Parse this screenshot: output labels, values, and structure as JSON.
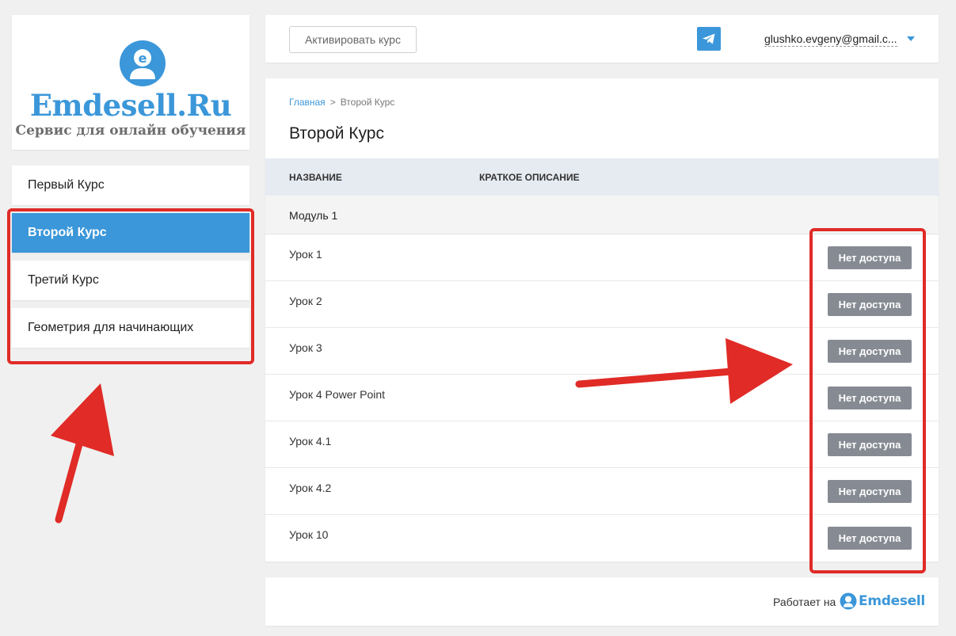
{
  "logo": {
    "title": "Emdesell.Ru",
    "subtitle": "Сервис для онлайн обучения"
  },
  "sidebar": {
    "items": [
      {
        "label": "Первый Курс",
        "active": false
      },
      {
        "label": "Второй Курс",
        "active": true
      },
      {
        "label": "Третий Курс",
        "active": false
      },
      {
        "label": "Геометрия для начинающих",
        "active": false
      }
    ]
  },
  "header": {
    "activate_label": "Активировать курс",
    "telegram_icon": "telegram-icon",
    "user_email": "glushko.evgeny@gmail.c..."
  },
  "breadcrumb": {
    "home": "Главная",
    "separator": ">",
    "current": "Второй Курс"
  },
  "page_title": "Второй Курс",
  "table": {
    "columns": [
      "Название",
      "Краткое описание"
    ],
    "module": "Модуль 1",
    "lessons": [
      {
        "title": "Урок 1",
        "status": "Нет доступа"
      },
      {
        "title": "Урок 2",
        "status": "Нет доступа"
      },
      {
        "title": "Урок 3",
        "status": "Нет доступа"
      },
      {
        "title": "Урок 4 Power Point",
        "status": "Нет доступа"
      },
      {
        "title": "Урок 4.1",
        "status": "Нет доступа"
      },
      {
        "title": "Урок 4.2",
        "status": "Нет доступа"
      },
      {
        "title": "Урок 10",
        "status": "Нет доступа"
      }
    ]
  },
  "footer": {
    "powered_by": "Работает на",
    "brand": "Emdesell"
  },
  "colors": {
    "accent": "#3b97d9",
    "disabled_button": "#868b93",
    "annotation": "#e02b27",
    "table_header": "#e6ebf2"
  }
}
